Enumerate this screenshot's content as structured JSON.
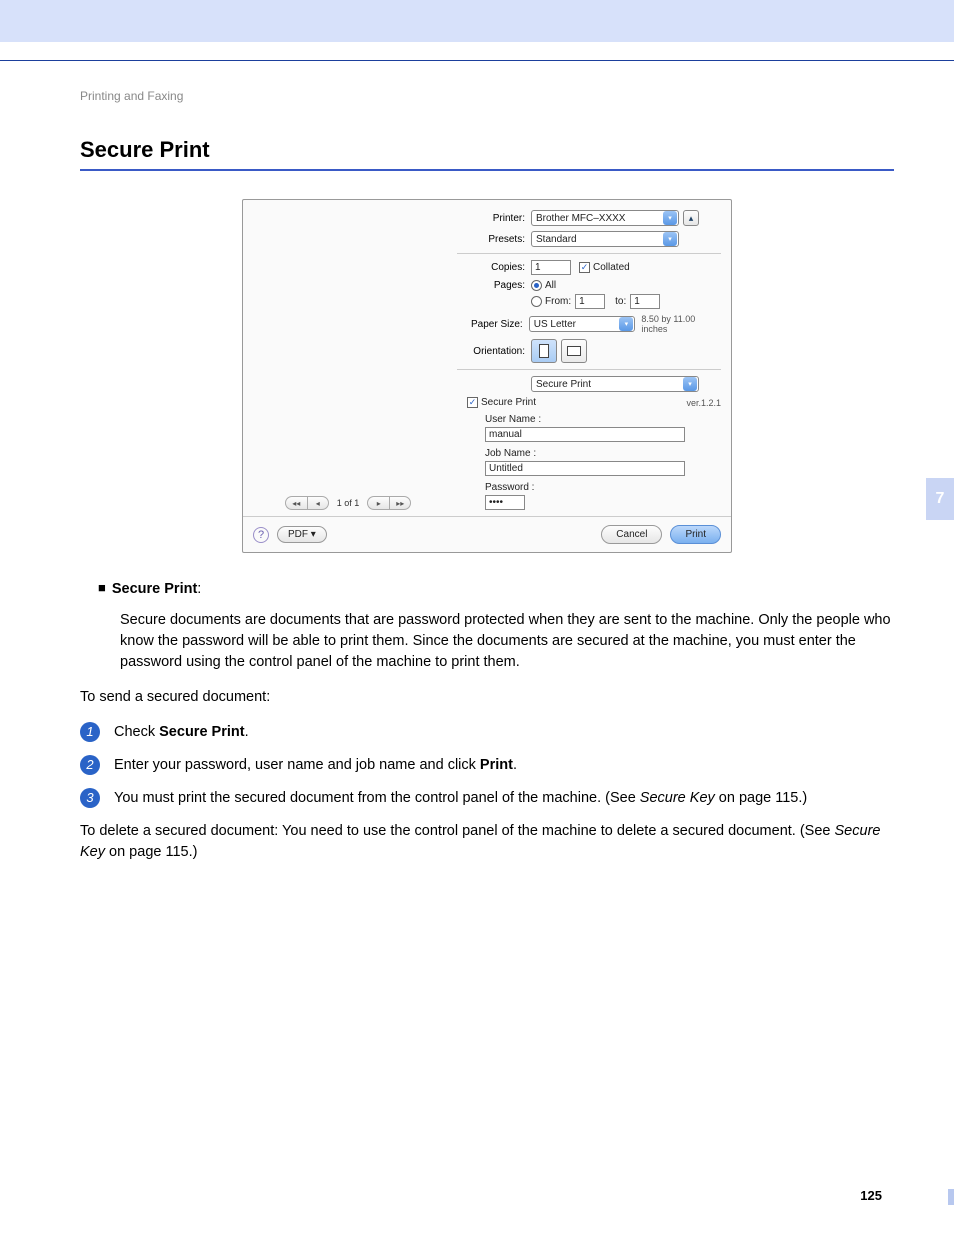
{
  "breadcrumb": "Printing and Faxing",
  "heading": "Secure Print",
  "dialog": {
    "printer_label": "Printer:",
    "printer_value": "Brother MFC–XXXX",
    "presets_label": "Presets:",
    "presets_value": "Standard",
    "copies_label": "Copies:",
    "copies_value": "1",
    "collated_label": "Collated",
    "pages_label": "Pages:",
    "pages_all": "All",
    "pages_from": "From:",
    "pages_from_val": "1",
    "pages_to": "to:",
    "pages_to_val": "1",
    "papersize_label": "Paper Size:",
    "papersize_value": "US Letter",
    "papersize_hint": "8.50 by 11.00 inches",
    "orientation_label": "Orientation:",
    "panel_value": "Secure Print",
    "secure_checkbox": "Secure Print",
    "version": "ver.1.2.1",
    "username_label": "User Name :",
    "username_value": "manual",
    "jobname_label": "Job Name :",
    "jobname_value": "Untitled",
    "password_label": "Password :",
    "password_value": "••••",
    "pager_text": "1 of 1",
    "pdf_btn": "PDF ▾",
    "cancel": "Cancel",
    "print": "Print"
  },
  "body": {
    "bullet_label": "Secure Print",
    "bullet_colon": ":",
    "desc": "Secure documents are documents that are password protected when they are sent to the machine. Only the people who know the password will be able to print them. Since the documents are secured at the machine, you must enter the password using the control panel of the machine to print them.",
    "send_intro": "To send a secured document:",
    "step1_a": "Check ",
    "step1_b": "Secure Print",
    "step1_c": ".",
    "step2_a": "Enter your password, user name and job name and click ",
    "step2_b": "Print",
    "step2_c": ".",
    "step3_a": "You must print the secured document from the control panel of the machine. (See ",
    "step3_b": "Secure Key",
    "step3_c": " on page 115.)",
    "delete_a": "To delete a secured document: You need to use the control panel of the machine to delete a secured document. (See ",
    "delete_b": "Secure Key",
    "delete_c": " on page 115.)"
  },
  "side_tab": "7",
  "page_number": "125"
}
